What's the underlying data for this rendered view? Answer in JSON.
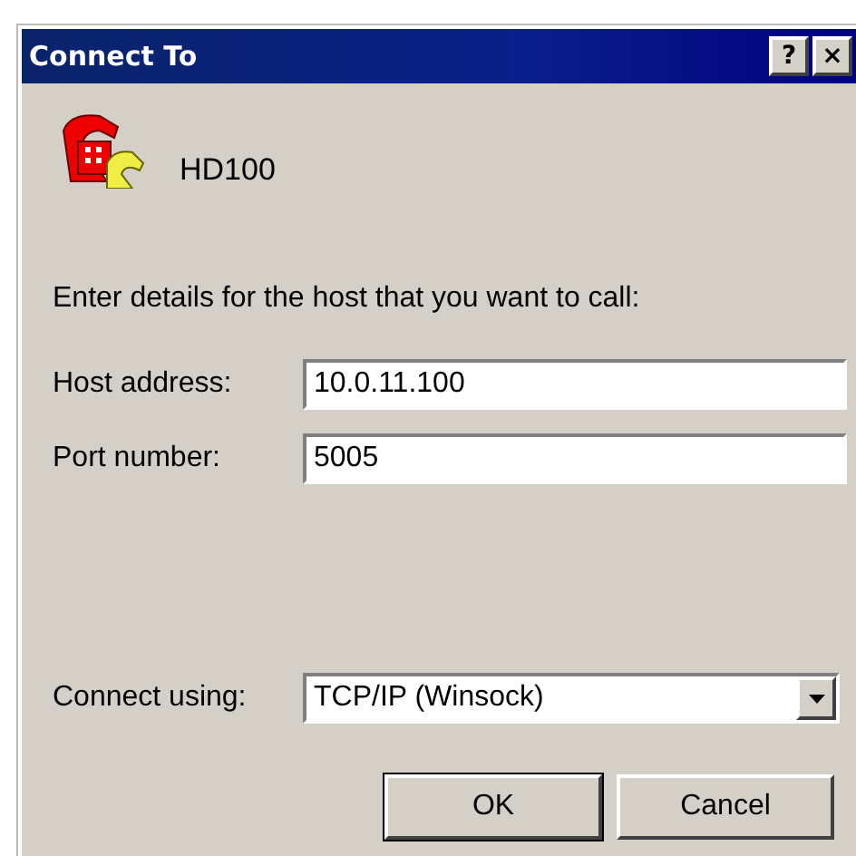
{
  "window": {
    "title": "Connect To",
    "title_buttons": [
      "?",
      "×"
    ]
  },
  "connection": {
    "name": "HD100"
  },
  "instructions": "Enter details for the host that you want to call:",
  "fields": [
    {
      "label": "Host address:",
      "value": "10.0.11.100"
    },
    {
      "label": "Port number:",
      "value": "5005"
    }
  ],
  "connect_using": {
    "label": "Connect using:",
    "value": "TCP/IP (Winsock)"
  },
  "buttons": [
    {
      "label": "OK",
      "default": true
    },
    {
      "label": "Cancel",
      "default": false
    }
  ]
}
